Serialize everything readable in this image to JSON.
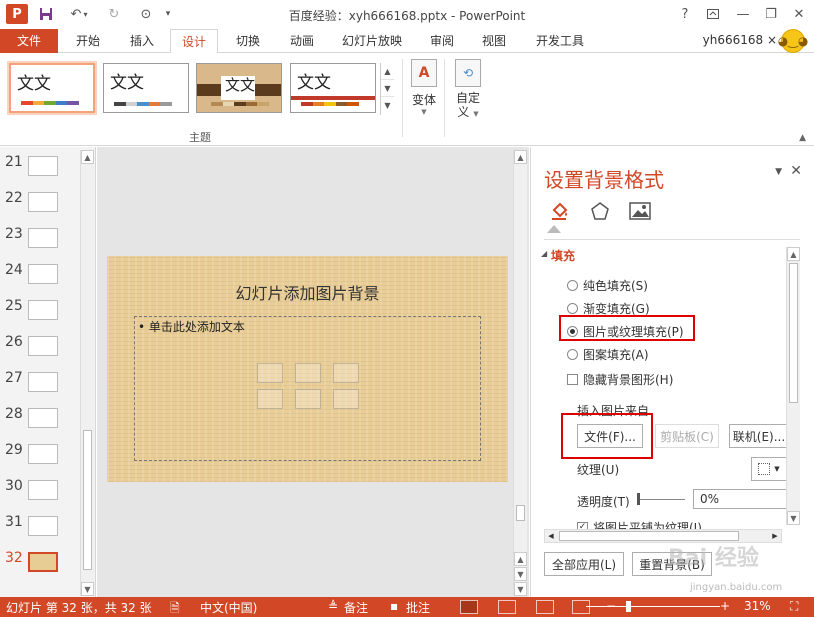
{
  "window": {
    "title": "百度经验：xyh666168.pptx - PowerPoint",
    "help": "?",
    "user": "yh666168 ×"
  },
  "tabs": [
    "文件",
    "开始",
    "插入",
    "设计",
    "切换",
    "动画",
    "幻灯片放映",
    "审阅",
    "视图",
    "开发工具"
  ],
  "active_tab": "设计",
  "ribbon": {
    "themes": [
      {
        "text": "文文",
        "colors": [
          "#e8452c",
          "#f1ad3c",
          "#71a830",
          "#3d7cc9",
          "#7556a6"
        ]
      },
      {
        "text": "文文",
        "colors": [
          "#444444",
          "#d0d0d0",
          "#4b8ec8",
          "#e07b39",
          "#9a9a9a"
        ]
      },
      {
        "text": "文文",
        "colors": [
          "#b58a52",
          "#e8d6b0",
          "#5b3b1e",
          "#9b6b35",
          "#c9a46b"
        ]
      },
      {
        "text": "文文",
        "colors": [
          "#c0392b",
          "#e67e22",
          "#f1c40f",
          "#8e5a2b",
          "#d35400"
        ]
      }
    ],
    "group_label": "主题",
    "variants_label": "变体",
    "customize_label": "自定\n义"
  },
  "slides_panel": {
    "numbers": [
      "21",
      "22",
      "23",
      "24",
      "25",
      "26",
      "27",
      "28",
      "29",
      "30",
      "31",
      "32"
    ],
    "current": "32"
  },
  "slide": {
    "title": "幻灯片添加图片背景",
    "placeholder": "• 单击此处添加文本"
  },
  "pane": {
    "title": "设置背景格式",
    "section": "填充",
    "options": [
      {
        "label": "纯色填充(S)",
        "selected": false
      },
      {
        "label": "渐变填充(G)",
        "selected": false
      },
      {
        "label": "图片或纹理填充(P)",
        "selected": true
      },
      {
        "label": "图案填充(A)",
        "selected": false
      }
    ],
    "hide_bg": "隐藏背景图形(H)",
    "insert_from": "插入图片来自",
    "file_btn": "文件(F)...",
    "clipboard_btn": "剪贴板(C)",
    "online_btn": "联机(E)...",
    "texture_label": "纹理(U)",
    "transparency_label": "透明度(T)",
    "transparency_value": "0%",
    "tile_label": "将图片平铺为纹理(I)",
    "apply_all": "全部应用(L)",
    "reset_bg": "重置背景(B)"
  },
  "status": {
    "slide_info": "幻灯片 第 32 张，共 32 张",
    "language": "中文(中国)",
    "notes": "备注",
    "comments": "批注",
    "zoom": "31%"
  },
  "watermark": {
    "text": "Bai 经验",
    "url": "jingyan.baidu.com"
  }
}
